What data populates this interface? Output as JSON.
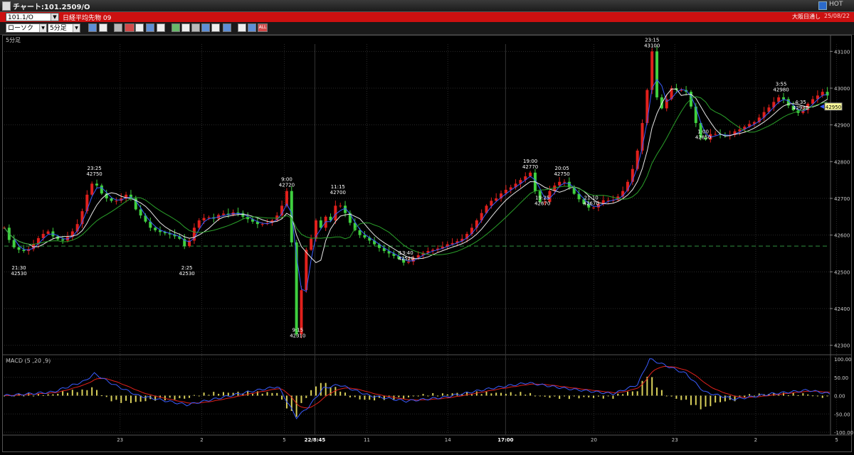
{
  "window": {
    "title": "チャート:101.2509/O",
    "hot_label": "HOT"
  },
  "infobar": {
    "symbol": "101.1/O",
    "instrument": "日経平均先物 09",
    "session": "大阪日通し",
    "date": "25/08/22"
  },
  "toolbar": {
    "chart_type": "ローソク",
    "interval": "5分足"
  },
  "main_chart": {
    "timeframe_label": "5分足",
    "last_price": "42950",
    "y_ticks": [
      "43100",
      "43000",
      "42900",
      "42800",
      "42700",
      "42600",
      "42500",
      "42400",
      "42300"
    ],
    "annotations": [
      {
        "time": "21:30",
        "price": "42530"
      },
      {
        "time": "23:25",
        "price": "42750"
      },
      {
        "time": "2:25",
        "price": "42530"
      },
      {
        "time": "9:00",
        "price": "42720"
      },
      {
        "time": "9:15",
        "price": "42310"
      },
      {
        "time": "11:15",
        "price": "42700"
      },
      {
        "time": "13:40",
        "price": "42520"
      },
      {
        "time": "19:00",
        "price": "42770"
      },
      {
        "time": "19:25",
        "price": "42670"
      },
      {
        "time": "20:05",
        "price": "42750"
      },
      {
        "time": "21:10",
        "price": "42670"
      },
      {
        "time": "23:15",
        "price": "43100"
      },
      {
        "time": "1:00",
        "price": "42850"
      },
      {
        "time": "3:55",
        "price": "42980"
      },
      {
        "time": "4:35",
        "price": "42930"
      }
    ]
  },
  "macd": {
    "label": "MACD (5 ,20 ,9)",
    "y_ticks": [
      "100.00",
      "50.00",
      "0.00",
      "-50.00",
      "-100.00"
    ]
  },
  "x_axis": {
    "ticks": [
      "23",
      "2",
      "5",
      "22/8:45",
      "11",
      "14",
      "17:00",
      "20",
      "23",
      "2",
      "5"
    ]
  },
  "colors": {
    "up": "#e0201c",
    "down": "#3fcf3f",
    "ma_short": "#3a5cff",
    "ma_mid": "#e8e8e8",
    "ma_long": "#2aa02a",
    "macd_line": "#3a5cff",
    "signal_line": "#e0201c",
    "histogram": "#d9d05a"
  },
  "chart_data": {
    "type": "candlestick",
    "panels": [
      "price",
      "macd"
    ],
    "price_path": [
      [
        0,
        42620
      ],
      [
        6,
        42570
      ],
      [
        12,
        42560
      ],
      [
        18,
        42555
      ],
      [
        24,
        42575
      ],
      [
        30,
        42600
      ],
      [
        36,
        42610
      ],
      [
        42,
        42590
      ],
      [
        48,
        42585
      ],
      [
        54,
        42600
      ],
      [
        58,
        42620
      ],
      [
        62,
        42640
      ],
      [
        66,
        42690
      ],
      [
        70,
        42730
      ],
      [
        74,
        42750
      ],
      [
        78,
        42720
      ],
      [
        84,
        42700
      ],
      [
        90,
        42690
      ],
      [
        96,
        42700
      ],
      [
        102,
        42715
      ],
      [
        108,
        42670
      ],
      [
        114,
        42645
      ],
      [
        120,
        42620
      ],
      [
        126,
        42610
      ],
      [
        132,
        42605
      ],
      [
        138,
        42600
      ],
      [
        144,
        42590
      ],
      [
        148,
        42570
      ],
      [
        150,
        42560
      ],
      [
        154,
        42610
      ],
      [
        160,
        42640
      ],
      [
        166,
        42650
      ],
      [
        172,
        42645
      ],
      [
        178,
        42660
      ],
      [
        184,
        42655
      ],
      [
        190,
        42665
      ],
      [
        196,
        42650
      ],
      [
        202,
        42640
      ],
      [
        208,
        42630
      ],
      [
        214,
        42630
      ],
      [
        220,
        42640
      ],
      [
        226,
        42660
      ],
      [
        230,
        42700
      ],
      [
        232,
        42720
      ],
      [
        234,
        42650
      ],
      [
        236,
        42580
      ],
      [
        238,
        42500
      ],
      [
        239,
        42400
      ],
      [
        240,
        42330
      ],
      [
        241,
        42310
      ],
      [
        242,
        42380
      ],
      [
        244,
        42450
      ],
      [
        246,
        42480
      ],
      [
        248,
        42560
      ],
      [
        252,
        42590
      ],
      [
        256,
        42640
      ],
      [
        260,
        42620
      ],
      [
        264,
        42650
      ],
      [
        268,
        42640
      ],
      [
        272,
        42680
      ],
      [
        274,
        42700
      ],
      [
        276,
        42680
      ],
      [
        280,
        42660
      ],
      [
        286,
        42620
      ],
      [
        292,
        42600
      ],
      [
        298,
        42590
      ],
      [
        304,
        42575
      ],
      [
        310,
        42560
      ],
      [
        316,
        42550
      ],
      [
        322,
        42540
      ],
      [
        326,
        42530
      ],
      [
        330,
        42520
      ],
      [
        334,
        42535
      ],
      [
        340,
        42545
      ],
      [
        346,
        42555
      ],
      [
        352,
        42560
      ],
      [
        358,
        42565
      ],
      [
        364,
        42575
      ],
      [
        370,
        42580
      ],
      [
        376,
        42590
      ],
      [
        382,
        42610
      ],
      [
        386,
        42630
      ],
      [
        392,
        42660
      ],
      [
        398,
        42690
      ],
      [
        404,
        42700
      ],
      [
        410,
        42720
      ],
      [
        416,
        42730
      ],
      [
        422,
        42745
      ],
      [
        428,
        42760
      ],
      [
        432,
        42770
      ],
      [
        436,
        42720
      ],
      [
        440,
        42690
      ],
      [
        442,
        42670
      ],
      [
        446,
        42710
      ],
      [
        450,
        42730
      ],
      [
        454,
        42740
      ],
      [
        458,
        42750
      ],
      [
        462,
        42740
      ],
      [
        466,
        42720
      ],
      [
        470,
        42705
      ],
      [
        474,
        42690
      ],
      [
        478,
        42680
      ],
      [
        482,
        42670
      ],
      [
        486,
        42680
      ],
      [
        490,
        42690
      ],
      [
        494,
        42700
      ],
      [
        498,
        42690
      ],
      [
        502,
        42700
      ],
      [
        506,
        42710
      ],
      [
        510,
        42730
      ],
      [
        514,
        42760
      ],
      [
        518,
        42800
      ],
      [
        522,
        42860
      ],
      [
        526,
        42950
      ],
      [
        530,
        43040
      ],
      [
        532,
        43100
      ],
      [
        534,
        43010
      ],
      [
        538,
        42940
      ],
      [
        542,
        42950
      ],
      [
        546,
        42990
      ],
      [
        550,
        43010
      ],
      [
        554,
        42980
      ],
      [
        558,
        43010
      ],
      [
        562,
        42970
      ],
      [
        566,
        42930
      ],
      [
        570,
        42880
      ],
      [
        574,
        42850
      ],
      [
        578,
        42870
      ],
      [
        582,
        42880
      ],
      [
        586,
        42870
      ],
      [
        590,
        42875
      ],
      [
        594,
        42865
      ],
      [
        598,
        42880
      ],
      [
        602,
        42885
      ],
      [
        606,
        42890
      ],
      [
        610,
        42900
      ],
      [
        614,
        42905
      ],
      [
        618,
        42910
      ],
      [
        622,
        42930
      ],
      [
        626,
        42940
      ],
      [
        630,
        42955
      ],
      [
        634,
        42970
      ],
      [
        638,
        42980
      ],
      [
        642,
        42960
      ],
      [
        646,
        42945
      ],
      [
        650,
        42935
      ],
      [
        654,
        42930
      ],
      [
        658,
        42950
      ],
      [
        662,
        42965
      ],
      [
        666,
        42975
      ],
      [
        670,
        42985
      ],
      [
        674,
        42995
      ],
      [
        676,
        42980
      ],
      [
        678,
        42975
      ]
    ],
    "price_ylim": [
      42280,
      43120
    ],
    "macd_ylim": [
      -100,
      100
    ],
    "macd_keypoints": [
      [
        0,
        0
      ],
      [
        40,
        10
      ],
      [
        66,
        40
      ],
      [
        74,
        60
      ],
      [
        90,
        30
      ],
      [
        110,
        0
      ],
      [
        150,
        -25
      ],
      [
        200,
        10
      ],
      [
        225,
        25
      ],
      [
        240,
        -60
      ],
      [
        250,
        -30
      ],
      [
        262,
        20
      ],
      [
        275,
        30
      ],
      [
        300,
        0
      ],
      [
        330,
        -15
      ],
      [
        360,
        -5
      ],
      [
        400,
        20
      ],
      [
        430,
        35
      ],
      [
        460,
        20
      ],
      [
        500,
        5
      ],
      [
        520,
        30
      ],
      [
        530,
        100
      ],
      [
        545,
        80
      ],
      [
        560,
        60
      ],
      [
        575,
        10
      ],
      [
        600,
        -10
      ],
      [
        630,
        5
      ],
      [
        660,
        15
      ],
      [
        678,
        5
      ]
    ]
  }
}
